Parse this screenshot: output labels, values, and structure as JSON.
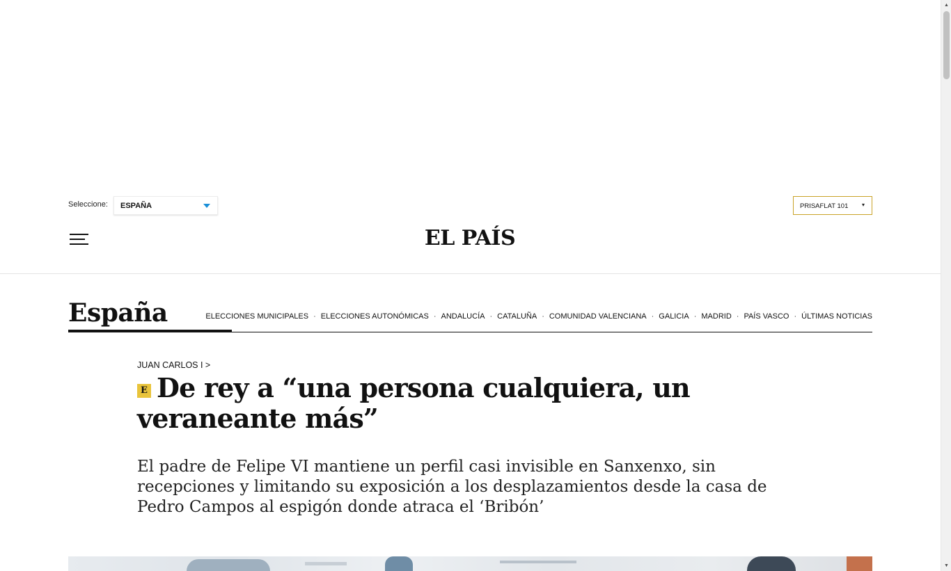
{
  "edition": {
    "label": "Seleccione:",
    "selected": "ESPAÑA"
  },
  "theme": {
    "selected": "PRISAFLAT 101",
    "caret": "▾"
  },
  "header": {
    "logo": "EL PAÍS"
  },
  "section": {
    "title": "España",
    "nav": [
      "ELECCIONES MUNICIPALES",
      "ELECCIONES AUTONÓMICAS",
      "ANDALUCÍA",
      "CATALUÑA",
      "COMUNIDAD VALENCIANA",
      "GALICIA",
      "MADRID",
      "PAÍS VASCO",
      "ÚLTIMAS NOTICIAS"
    ],
    "separator": "·"
  },
  "article": {
    "kicker": "JUAN CARLOS I >",
    "badge": "E",
    "headline": "De rey a “una persona cualquiera, un veraneante más”",
    "subtitle": "El padre de Felipe VI mantiene un perfil casi invisible en Sanxenxo, sin recepciones y limitando su exposición a los desplazamientos desde la casa de Pedro Campos al espigón donde atraca el ‘Bribón’"
  },
  "scrollbar": {
    "up": "▲",
    "down": "▼"
  },
  "icons": {
    "menu": "hamburger-menu-icon",
    "edition_caret": "triangle-down-icon",
    "premium": "el-pais-premium-icon"
  },
  "colors": {
    "edition_caret": "#1a8fd8",
    "theme_border": "#c9a227",
    "premium_badge": "#e9c43b"
  }
}
